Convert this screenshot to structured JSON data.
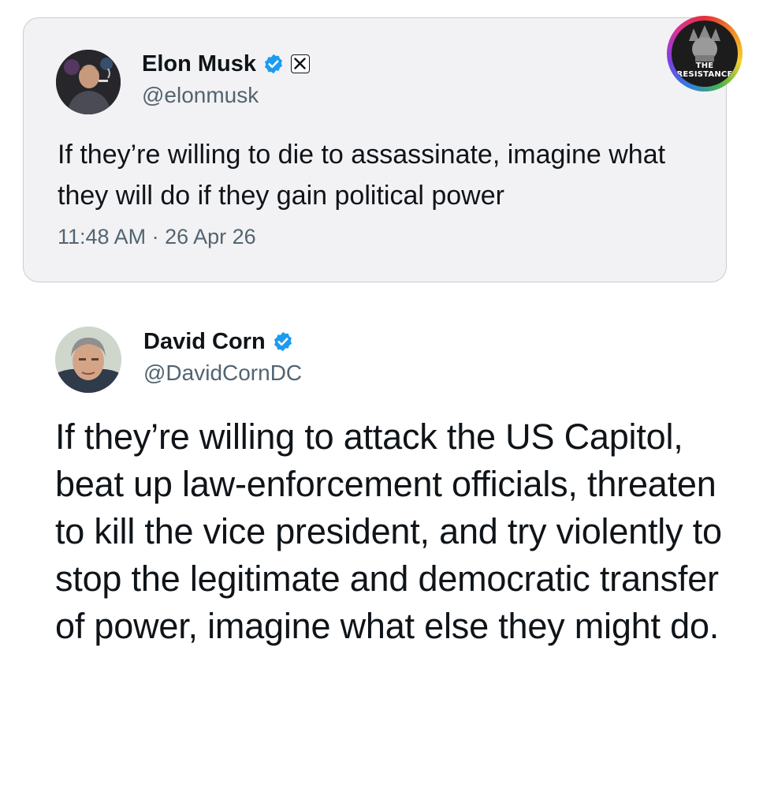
{
  "quoted_tweet": {
    "display_name": "Elon Musk",
    "handle": "@elonmusk",
    "verified_icon": "verified-badge-icon",
    "affiliate_icon": "x-logo-icon",
    "text": "If they’re willing to die to assassinate, imagine what they will do if they gain political power",
    "timestamp": "11:48 AM · 26 Apr 26"
  },
  "main_tweet": {
    "display_name": "David Corn",
    "handle": "@DavidCornDC",
    "verified_icon": "verified-badge-icon",
    "text": "If they’re willing to attack the US Capitol, beat up law-enforcement officials, threaten to kill the vice president, and try violently to stop the legitimate and democratic transfer of power, imagine what else they might do."
  },
  "watermark": {
    "line1": "THE",
    "line2": "RESISTANCE"
  },
  "colors": {
    "verified_blue": "#1d9bf0",
    "card_background": "#f2f2f4",
    "secondary_text": "#536471",
    "primary_text": "#0f1419"
  }
}
